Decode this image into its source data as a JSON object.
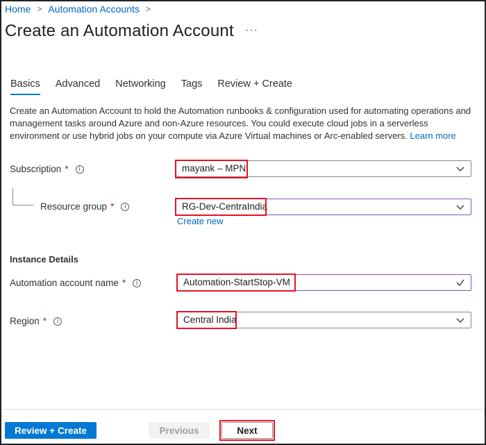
{
  "breadcrumb": {
    "home": "Home",
    "automation_accounts": "Automation Accounts"
  },
  "page": {
    "title": "Create an Automation Account",
    "more_glyph": "···"
  },
  "tabs": [
    {
      "label": "Basics",
      "active": true
    },
    {
      "label": "Advanced",
      "active": false
    },
    {
      "label": "Networking",
      "active": false
    },
    {
      "label": "Tags",
      "active": false
    },
    {
      "label": "Review + Create",
      "active": false
    }
  ],
  "description": {
    "text": "Create an Automation Account to hold the Automation runbooks & configuration used for automating operations and management tasks around Azure and non-Azure resources. You could execute cloud jobs in a serverless environment or use hybrid jobs on your compute via Azure Virtual machines or Arc-enabled servers.",
    "learn_more": "Learn more"
  },
  "form": {
    "subscription": {
      "label": "Subscription",
      "required": "*",
      "value": "mayank – MPN"
    },
    "resource_group": {
      "label": "Resource group",
      "required": "*",
      "value": "RG-Dev-CentraIndia",
      "create_new": "Create new"
    },
    "instance_details_heading": "Instance Details",
    "account_name": {
      "label": "Automation account name",
      "required": "*",
      "value": "Automation-StartStop-VM"
    },
    "region": {
      "label": "Region",
      "required": "*",
      "value": "Central India"
    }
  },
  "footer": {
    "review_create": "Review + Create",
    "previous": "Previous",
    "next": "Next"
  },
  "colors": {
    "accent": "#0078d4",
    "link": "#0067b8",
    "highlight": "#e81123",
    "required": "#a4262c"
  }
}
